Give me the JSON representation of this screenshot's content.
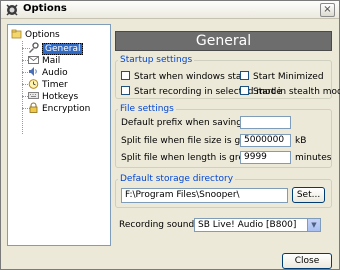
{
  "window": {
    "title": "Options",
    "close_glyph": "×"
  },
  "tree": {
    "root": "Options",
    "items": [
      {
        "label": "General",
        "icon": "general-icon"
      },
      {
        "label": "Mail",
        "icon": "mail-icon"
      },
      {
        "label": "Audio",
        "icon": "audio-icon"
      },
      {
        "label": "Timer",
        "icon": "timer-icon"
      },
      {
        "label": "Hotkeys",
        "icon": "hotkeys-icon"
      },
      {
        "label": "Encryption",
        "icon": "lock-icon"
      }
    ],
    "selected": "General"
  },
  "page_title": "General",
  "startup": {
    "legend": "Startup settings",
    "start_windows": "Start when windows start",
    "start_minimized": "Start Minimized",
    "start_recording": "Start recording in selected mode",
    "start_stealth": "Start in stealth mode"
  },
  "file": {
    "legend": "File settings",
    "prefix_label": "Default prefix when saving files",
    "prefix_value": "",
    "size_label": "Split file when file size is greater than",
    "size_value": "5000000",
    "size_unit": "kB",
    "length_label": "Split file when length is greater than",
    "length_value": "9999",
    "length_unit": "minutes"
  },
  "storage": {
    "legend": "Default storage directory",
    "path": "F:\\Program Files\\Snooper\\",
    "set_label": "Set..."
  },
  "sound": {
    "label": "Recording sound card",
    "selected": "SB Live! Audio [B800]"
  },
  "close_label": "Close",
  "colors": {
    "accent": "#0046d5",
    "header_bg": "#6d6d6d",
    "selection": "#316ac5"
  }
}
